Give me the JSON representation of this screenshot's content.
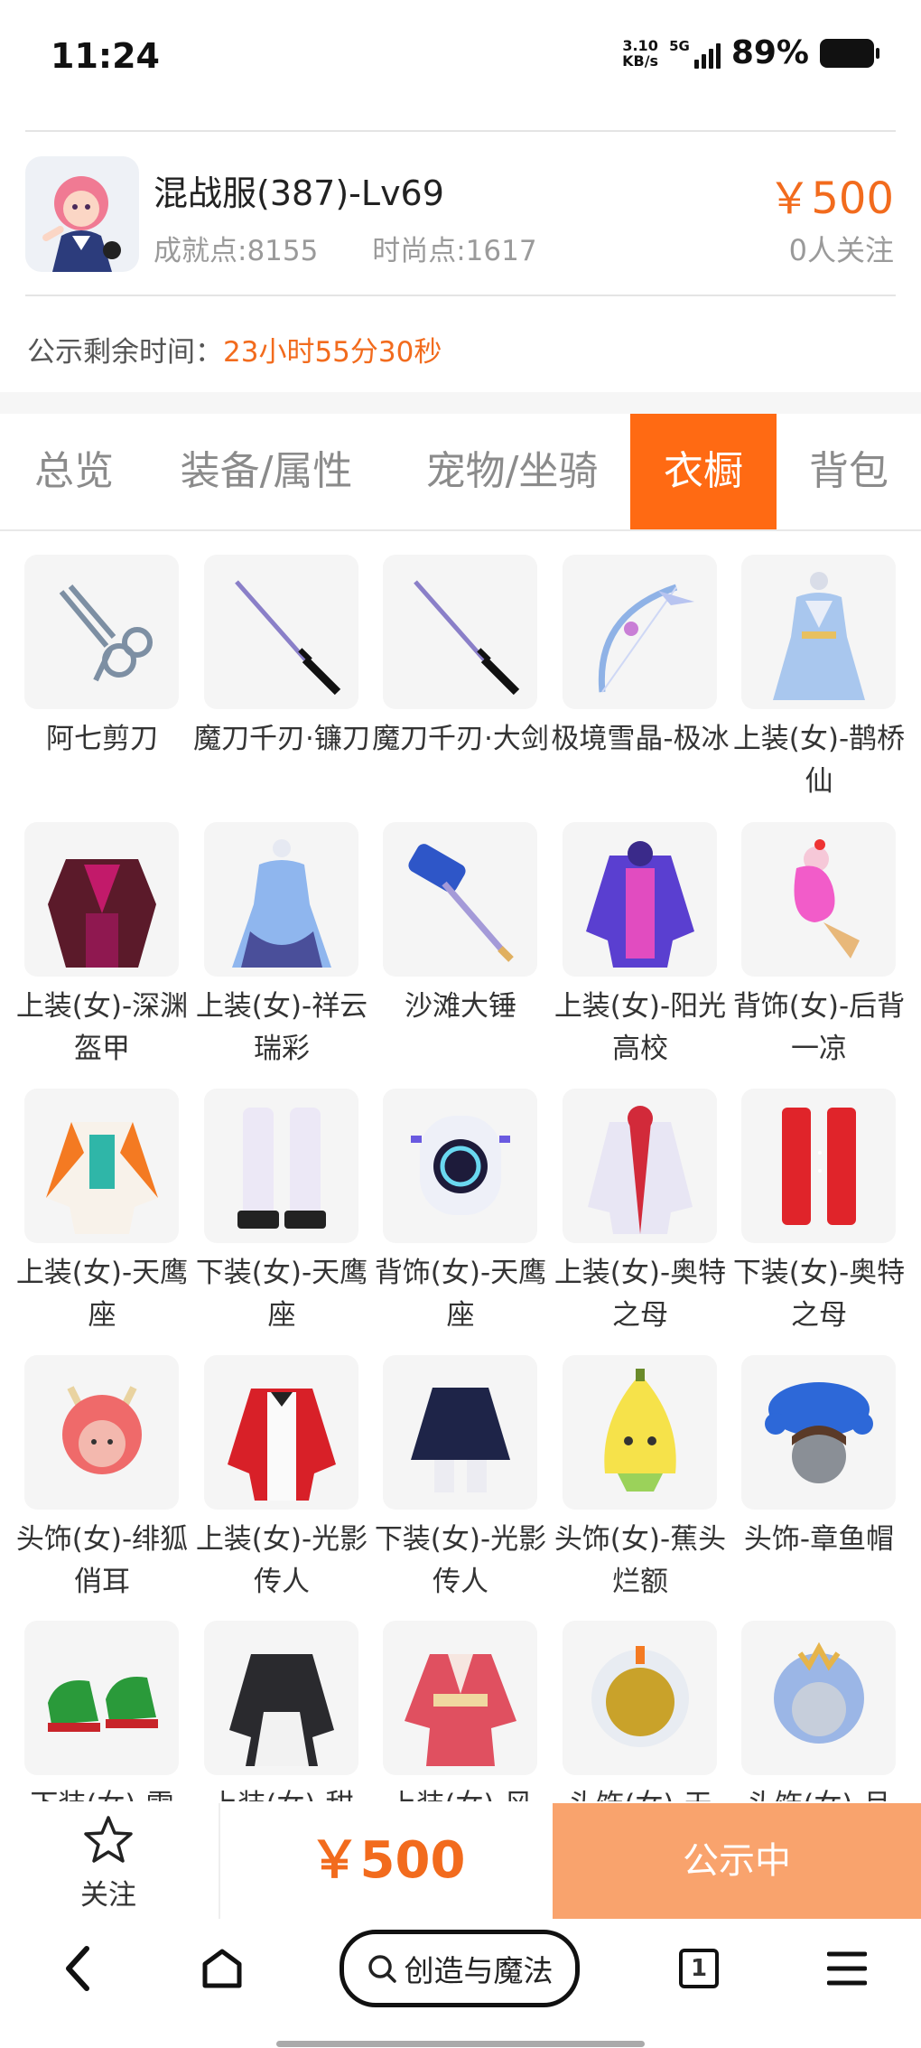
{
  "status_bar": {
    "time": "11:24",
    "net_speed_value": "3.10",
    "net_speed_unit": "KB/s",
    "network": "5G",
    "battery": "89%"
  },
  "listing": {
    "title": "混战服(387)-Lv69",
    "achievement": "成就点:8155",
    "fashion": "时尚点:1617",
    "price": "￥500",
    "followers": "0人关注",
    "countdown_label": "公示剩余时间：",
    "countdown_value": "23小时55分30秒"
  },
  "tabs": [
    {
      "label": "总览",
      "active": false
    },
    {
      "label": "装备/属性",
      "active": false
    },
    {
      "label": "宠物/坐骑",
      "active": false
    },
    {
      "label": "衣橱",
      "active": true
    },
    {
      "label": "背包",
      "active": false
    }
  ],
  "items": [
    {
      "name": "阿七剪刀",
      "icon": "scissors-icon"
    },
    {
      "name": "魔刀千刃·镰刀",
      "icon": "katana-icon"
    },
    {
      "name": "魔刀千刃·大剑",
      "icon": "katana-icon"
    },
    {
      "name": "极境雪晶-极冰",
      "icon": "bow-icon"
    },
    {
      "name": "上装(女)-鹊桥仙",
      "icon": "dress-icon"
    },
    {
      "name": "上装(女)-深渊盔甲",
      "icon": "armor-icon"
    },
    {
      "name": "上装(女)-祥云瑞彩",
      "icon": "dress-icon"
    },
    {
      "name": "沙滩大锤",
      "icon": "hammer-icon"
    },
    {
      "name": "上装(女)-阳光高校",
      "icon": "jacket-icon"
    },
    {
      "name": "背饰(女)-后背一凉",
      "icon": "icecream-icon"
    },
    {
      "name": "上装(女)-天鹰座",
      "icon": "jacket-icon"
    },
    {
      "name": "下装(女)-天鹰座",
      "icon": "boots-icon"
    },
    {
      "name": "背饰(女)-天鹰座",
      "icon": "backpack-icon"
    },
    {
      "name": "上装(女)-奥特之母",
      "icon": "suit-icon"
    },
    {
      "name": "下装(女)-奥特之母",
      "icon": "boots-icon"
    },
    {
      "name": "头饰(女)-绯狐俏耳",
      "icon": "head-icon"
    },
    {
      "name": "上装(女)-光影传人",
      "icon": "jacket-icon"
    },
    {
      "name": "下装(女)-光影传人",
      "icon": "skirt-icon"
    },
    {
      "name": "头饰(女)-蕉头烂额",
      "icon": "banana-icon"
    },
    {
      "name": "头饰-章鱼帽",
      "icon": "octopus-icon"
    },
    {
      "name": "下装(女)-雪",
      "icon": "shoes-icon"
    },
    {
      "name": "上装(女)-甜",
      "icon": "maid-icon"
    },
    {
      "name": "上装(女)-风",
      "icon": "kimono-icon"
    },
    {
      "name": "头饰(女)-天",
      "icon": "helmet-icon"
    },
    {
      "name": "头饰(女)-月",
      "icon": "head-icon"
    }
  ],
  "bottom_bar": {
    "follow_label": "关注",
    "price": "￥500",
    "status_button": "公示中"
  },
  "browser": {
    "search_text": "创造与魔法",
    "tab_count": "1"
  },
  "colors": {
    "accent": "#f26b1d",
    "tab_active": "#ff6a13",
    "status_button": "#f9a36d"
  }
}
